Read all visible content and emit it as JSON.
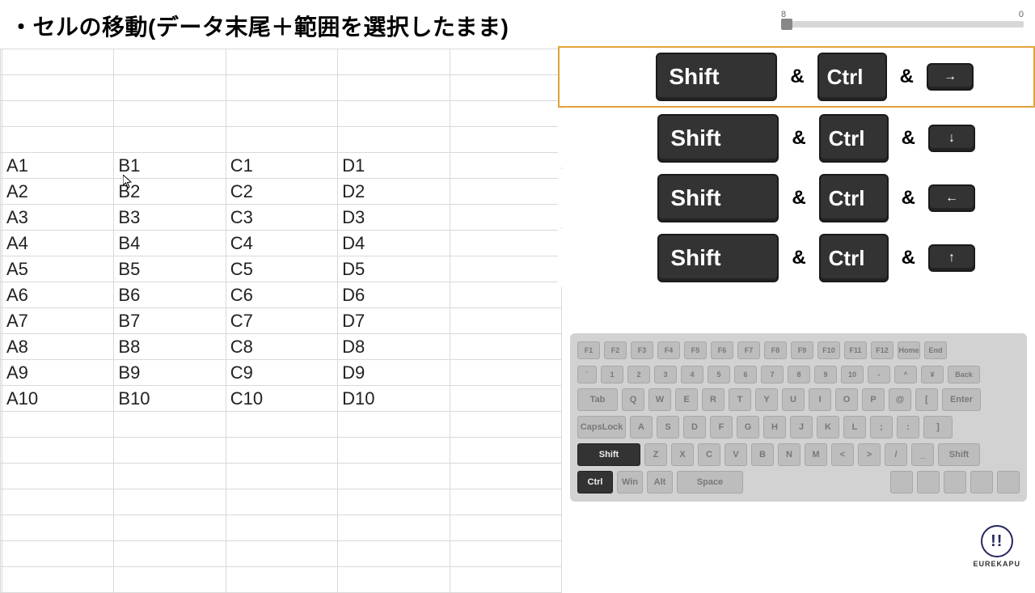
{
  "title": "・セルの移動(データ末尾＋範囲を選択したまま)",
  "slider": {
    "left": "8",
    "right": "0"
  },
  "grid": {
    "startRow": 5,
    "rows": [
      [
        "A1",
        "B1",
        "C1",
        "D1"
      ],
      [
        "A2",
        "B2",
        "C2",
        "D2"
      ],
      [
        "A3",
        "B3",
        "C3",
        "D3"
      ],
      [
        "A4",
        "B4",
        "C4",
        "D4"
      ],
      [
        "A5",
        "B5",
        "C5",
        "D5"
      ],
      [
        "A6",
        "B6",
        "C6",
        "D6"
      ],
      [
        "A7",
        "B7",
        "C7",
        "D7"
      ],
      [
        "A8",
        "B8",
        "C8",
        "D8"
      ],
      [
        "A9",
        "B9",
        "C9",
        "D9"
      ],
      [
        "A10",
        "B10",
        "C10",
        "D10"
      ]
    ]
  },
  "combos": {
    "shift": "Shift",
    "ctrl": "Ctrl",
    "amp": "&",
    "arrows": [
      "→",
      "↓",
      "←",
      "↑"
    ],
    "highlighted": 0
  },
  "kb": {
    "r0": [
      "F1",
      "F2",
      "F3",
      "F4",
      "F5",
      "F6",
      "F7",
      "F8",
      "F9",
      "F10",
      "F11",
      "F12",
      "Home",
      "End"
    ],
    "r1": [
      "`",
      "1",
      "2",
      "3",
      "4",
      "5",
      "6",
      "7",
      "8",
      "9",
      "10",
      "-",
      "^",
      "¥",
      "Back"
    ],
    "r2": [
      "Tab",
      "Q",
      "W",
      "E",
      "R",
      "T",
      "Y",
      "U",
      "I",
      "O",
      "P",
      "@",
      "[",
      "Enter"
    ],
    "r3": [
      "CapsLock",
      "A",
      "S",
      "D",
      "F",
      "G",
      "H",
      "J",
      "K",
      "L",
      ";",
      ":",
      "]"
    ],
    "r4": [
      "Shift",
      "Z",
      "X",
      "C",
      "V",
      "B",
      "N",
      "M",
      "<",
      ">",
      "/",
      "_",
      "Shift"
    ],
    "r5": [
      "Ctrl",
      "Win",
      "Alt",
      "Space",
      "",
      "",
      "",
      "",
      ""
    ]
  },
  "logo": {
    "mark": "!!",
    "text": "EUREKAPU"
  }
}
